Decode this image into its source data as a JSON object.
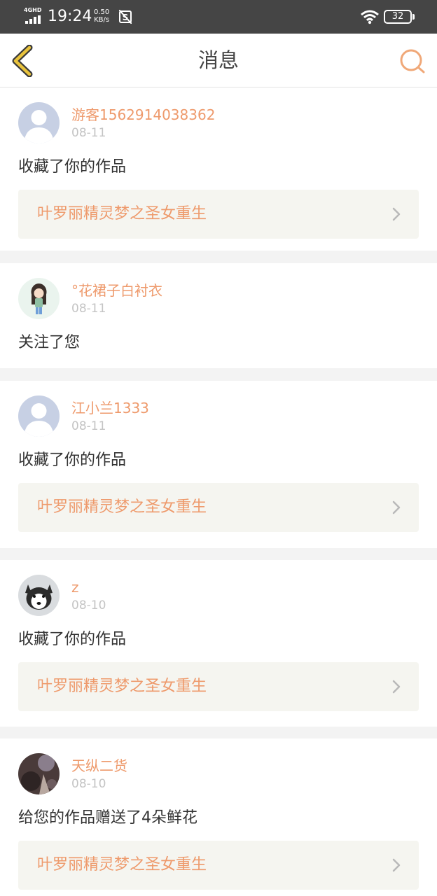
{
  "status_bar": {
    "network": "4GHD",
    "time": "19:24",
    "speed_value": "0.50",
    "speed_unit": "KB/s",
    "battery": "32"
  },
  "header": {
    "title": "消息",
    "back_icon": "chevron-left-icon",
    "search_icon": "search-icon"
  },
  "colors": {
    "accent": "#ee9a6c",
    "back_arrow": "#e9c33c",
    "status_bar": "#454545",
    "work_box": "#f5f5f0"
  },
  "messages": [
    {
      "username": "游客1562914038362",
      "date": "08-11",
      "action": "收藏了你的作品",
      "work": "叶罗丽精灵梦之圣女重生",
      "avatar": "default-avatar"
    },
    {
      "username": "°花裙子白衬衣",
      "date": "08-11",
      "action": "关注了您",
      "avatar": "girl-avatar"
    },
    {
      "username": "江小兰1333",
      "date": "08-11",
      "action": "收藏了你的作品",
      "work": "叶罗丽精灵梦之圣女重生",
      "avatar": "default-avatar"
    },
    {
      "username": "z",
      "date": "08-10",
      "action": "收藏了你的作品",
      "work": "叶罗丽精灵梦之圣女重生",
      "avatar": "husky-avatar"
    },
    {
      "username": "天纵二货",
      "date": "08-10",
      "action": "给您的作品赠送了4朵鲜花",
      "work": "叶罗丽精灵梦之圣女重生",
      "avatar": "photo-avatar"
    }
  ]
}
